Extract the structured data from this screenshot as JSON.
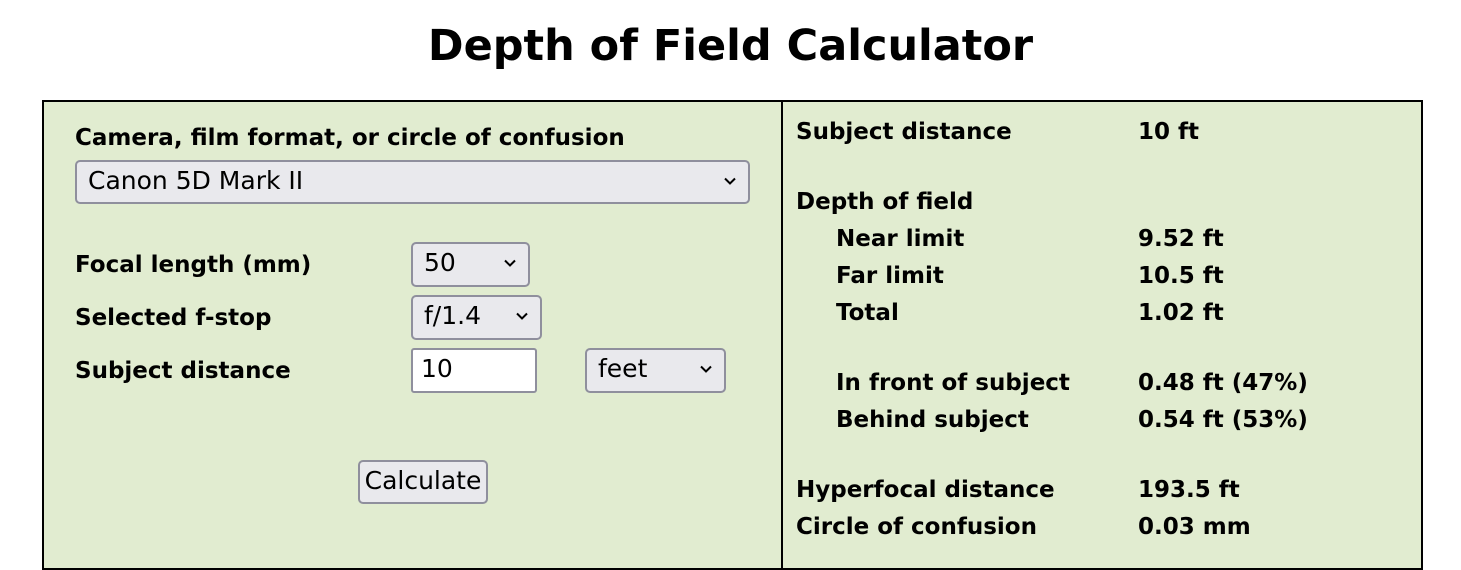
{
  "page_title": "Depth of Field Calculator",
  "form": {
    "camera_label": "Camera, film format, or circle of confusion",
    "camera_value": "Canon 5D Mark II",
    "focal_length_label": "Focal length (mm)",
    "focal_length_value": "50",
    "fstop_label": "Selected f-stop",
    "fstop_value": "f/1.4",
    "distance_label": "Subject distance",
    "distance_value": "10",
    "distance_unit": "feet",
    "calculate_label": "Calculate"
  },
  "results": {
    "subject_distance_label": "Subject distance",
    "subject_distance_value": "10 ft",
    "dof_heading": "Depth of field",
    "near_limit_label": "Near limit",
    "near_limit_value": "9.52 ft",
    "far_limit_label": "Far limit",
    "far_limit_value": "10.5 ft",
    "total_label": "Total",
    "total_value": "1.02 ft",
    "in_front_label": "In front of subject",
    "in_front_value": "0.48 ft (47%)",
    "behind_label": "Behind subject",
    "behind_value": "0.54 ft (53%)",
    "hyperfocal_label": "Hyperfocal distance",
    "hyperfocal_value": "193.5 ft",
    "coc_label": "Circle of confusion",
    "coc_value": "0.03 mm"
  }
}
